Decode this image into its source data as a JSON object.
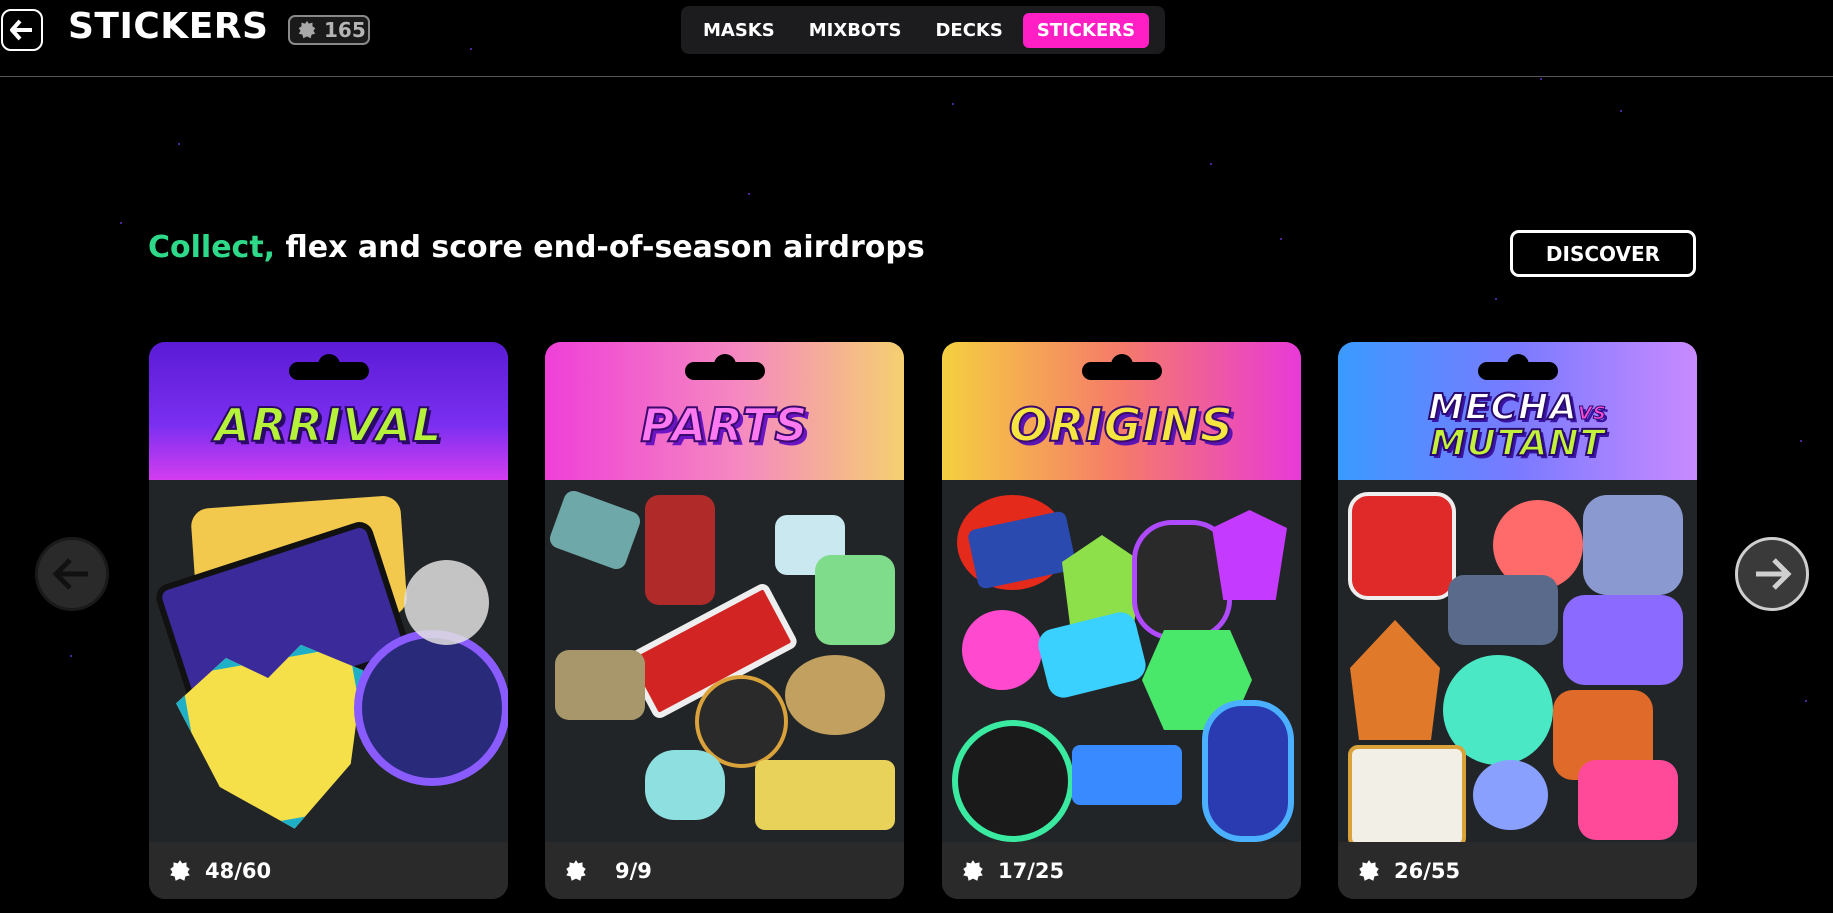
{
  "header": {
    "title": "STICKERS",
    "counter": "165",
    "tabs": [
      {
        "label": "MASKS",
        "active": false
      },
      {
        "label": "MIXBOTS",
        "active": false
      },
      {
        "label": "DECKS",
        "active": false
      },
      {
        "label": "STICKERS",
        "active": true
      }
    ]
  },
  "headline": {
    "accent": "Collect,",
    "rest": " flex and score end-of-season airdrops"
  },
  "discover_label": "DISCOVER",
  "packs": [
    {
      "title": "ARRIVAL",
      "count": "48/60"
    },
    {
      "title": "PARTS",
      "count": "9/9"
    },
    {
      "title": "ORIGINS",
      "count": "17/25"
    },
    {
      "title_line1": "MECHA",
      "title_vs": "VS",
      "title_line2": "MUTANT",
      "count": "26/55"
    }
  ],
  "icons": {
    "back": "back-arrow-icon",
    "counter": "gear-icon",
    "nav_prev": "arrow-left-icon",
    "nav_next": "arrow-right-icon",
    "pack_count": "gear-icon"
  },
  "colors": {
    "accent_green": "#2fd98a",
    "active_tab": "#ff1fc4",
    "background": "#000000"
  }
}
